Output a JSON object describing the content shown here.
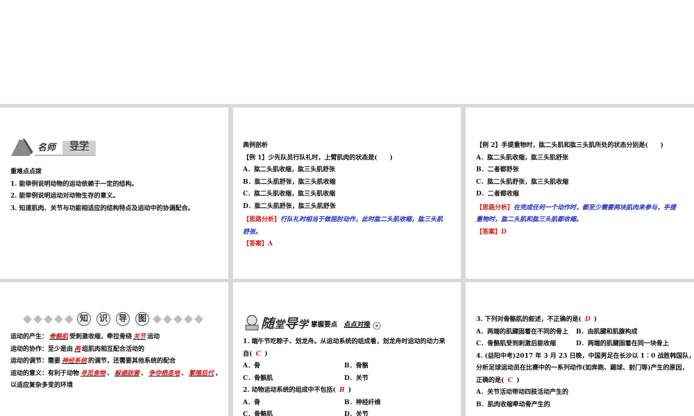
{
  "slide1": {
    "banner_left": "名师",
    "banner_right": "导学",
    "heading": "重难点点拨",
    "items": [
      "1.  能举例说明动物的运动依赖于一定的结构。",
      "2.  能举例说明运动对动物生存的意义。",
      "3.  知道肌肉、关节与功能相适应的结构特点及运动中的协调配合。"
    ]
  },
  "slide2": {
    "heading": "典例剖析",
    "question": "【例 1】少先队员行队礼时，上臂肌肉的状态是(　　)",
    "options": [
      "A．肱二头肌收缩，肱三头肌舒张",
      "B．肱二头肌舒张，肱三头肌收缩",
      "C．肱二头肌收缩，肱三头肌收缩",
      "D．肱二头肌舒张，肱三头肌舒张"
    ],
    "analysis_tag": "【思路分析】",
    "analysis_line1": "行队礼时相当于做屈肘动作，此时肱二头肌收缩，肱三头肌",
    "analysis_line2": "舒张。",
    "answer_tag": "【答案】",
    "answer": "A"
  },
  "slide3": {
    "question": "【例 2】手提重物时，肱二头肌和肱三头肌所处的状态分别是(　　)",
    "options": [
      "A．肱二头肌收缩，肱三头肌舒张",
      "B．二者都舒张",
      "C．肱二头肌舒张，肱三头肌收缩",
      "D．二者都收缩"
    ],
    "analysis_tag": "【思路分析】",
    "analysis_line1": "在完成任何一个动作时，都至少需要两块肌肉来参与，手提",
    "analysis_line2": "重物时，肱二头肌和肱三头肌都收缩。",
    "answer_tag": "【答案】",
    "answer": "D"
  },
  "slide4": {
    "header_chars": [
      "知",
      "识",
      "导",
      "图"
    ],
    "l1_a": "运动的产生：",
    "l1_f1": "骨骼肌",
    "l1_b": "受刺激收缩，牵拉骨绕",
    "l1_f2": "关节",
    "l1_c": "运动",
    "l2_a": "运动的协作：至少是由",
    "l2_f1": "两",
    "l2_b": "组肌肉相互配合活动的",
    "l3_a": "运动的调节：需要",
    "l3_f1": "神经系统",
    "l3_b": "的调节，还需要其他系统的配合",
    "l4_a": "运动的意义：有利于动物",
    "l4_f1": "寻觅食物",
    "l4_f2": "躲避敌害",
    "l4_f3": "争夺栖息地",
    "l4_f4": "繁殖后代",
    "l5": "以适应复杂多变的环境",
    "sep": "、",
    "comma": "，"
  },
  "slide5": {
    "logo_a": "随",
    "logo_b": "堂",
    "logo_c": "导",
    "logo_d": "学",
    "logo_tail_a": "掌握要点",
    "logo_tail_b": "点点对接",
    "q1_line1": "1.  端午节吃粽子、划龙舟。从运动系统的组成看，划龙舟时运动的动力来",
    "q1_line2_a": "自(",
    "q1_answer": "C",
    "q1_line2_b": ")",
    "q1_options": [
      "A．骨",
      "B．骨骼",
      "C．骨骼肌",
      "D．关节"
    ],
    "q2_line_a": "2.  动物运动系统的组成中不包括(",
    "q2_answer": "B",
    "q2_line_b": ")",
    "q2_options": [
      "A．骨",
      "B．神经纤维",
      "C．骨骼肌",
      "D．关节"
    ]
  },
  "slide6": {
    "q3_a": "3.  下列对骨骼肌的叙述，不正确的是(",
    "q3_answer": "D",
    "q3_b": ")",
    "q3_options": [
      "A．两端的肌腱固着在不同的骨上",
      "B．由肌腱和肌腹构成",
      "C．骨骼肌受到刺激后能收缩",
      "D．两端的肌腱固着在同一块骨上"
    ],
    "q4_line1": "4.  (益阳中考)2017 年 3 月 23 日晚，中国男足在长沙以 1∶0 战胜韩国队，",
    "q4_line2": "分析足球运动员在比赛中的一系列动作(如奔跑、踢球、射门等)产生的原因，",
    "q4_line3_a": "正确的是(",
    "q4_answer": "C",
    "q4_line3_b": ")",
    "q4_options": [
      "A．关节活动带动四肢活动产生的",
      "B．肌肉收缩牵动骨产生的"
    ]
  }
}
